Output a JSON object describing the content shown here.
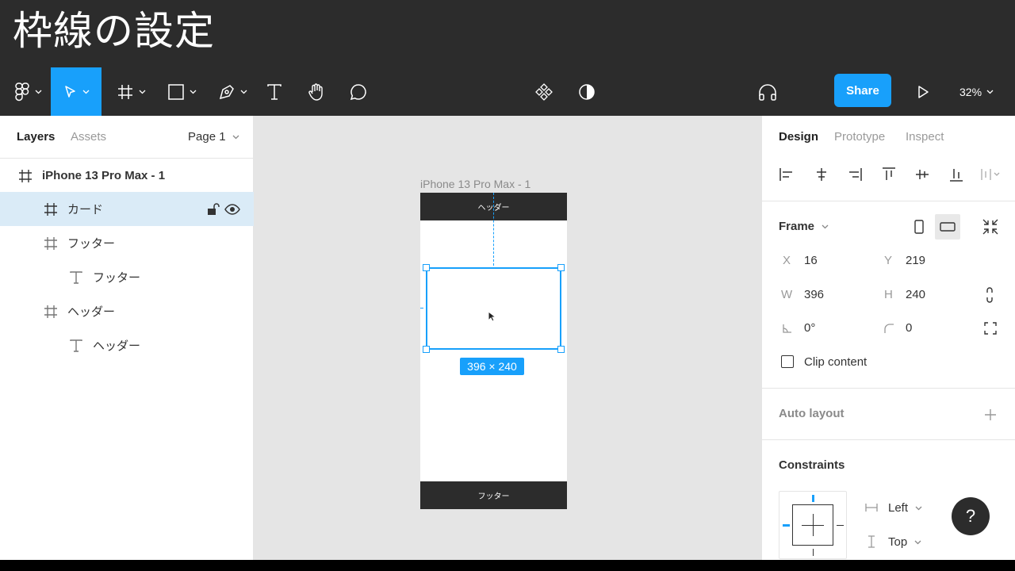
{
  "title": "枠線の設定",
  "toolbar": {
    "share_label": "Share",
    "zoom": "32%"
  },
  "left_panel": {
    "tabs": [
      "Layers",
      "Assets"
    ],
    "page": "Page 1",
    "layers": [
      {
        "name": "iPhone 13 Pro Max - 1",
        "icon": "frame-icon"
      },
      {
        "name": "カード",
        "icon": "frame-icon"
      },
      {
        "name": "フッター",
        "icon": "frame-icon"
      },
      {
        "name": "フッター",
        "icon": "text-icon"
      },
      {
        "name": "ヘッダー",
        "icon": "frame-icon"
      },
      {
        "name": "ヘッダー",
        "icon": "text-icon"
      }
    ]
  },
  "canvas": {
    "frame_label": "iPhone 13 Pro Max - 1",
    "header_text": "ヘッダー",
    "footer_text": "フッター",
    "dimension_badge": "396 × 240"
  },
  "right_panel": {
    "tabs": [
      "Design",
      "Prototype",
      "Inspect"
    ],
    "frame_title": "Frame",
    "x_label": "X",
    "x_value": "16",
    "y_label": "Y",
    "y_value": "219",
    "w_label": "W",
    "w_value": "396",
    "h_label": "H",
    "h_value": "240",
    "rotation": "0°",
    "radius": "0",
    "clip_content": "Clip content",
    "auto_layout": "Auto layout",
    "constraints": "Constraints",
    "constraint_h": "Left",
    "constraint_v": "Top"
  },
  "help": "?",
  "colors": {
    "accent": "#18a0fb",
    "toolbar_bg": "#2c2c2c",
    "selected_layer_bg": "#daebf7",
    "canvas_bg": "#e5e5e5"
  }
}
